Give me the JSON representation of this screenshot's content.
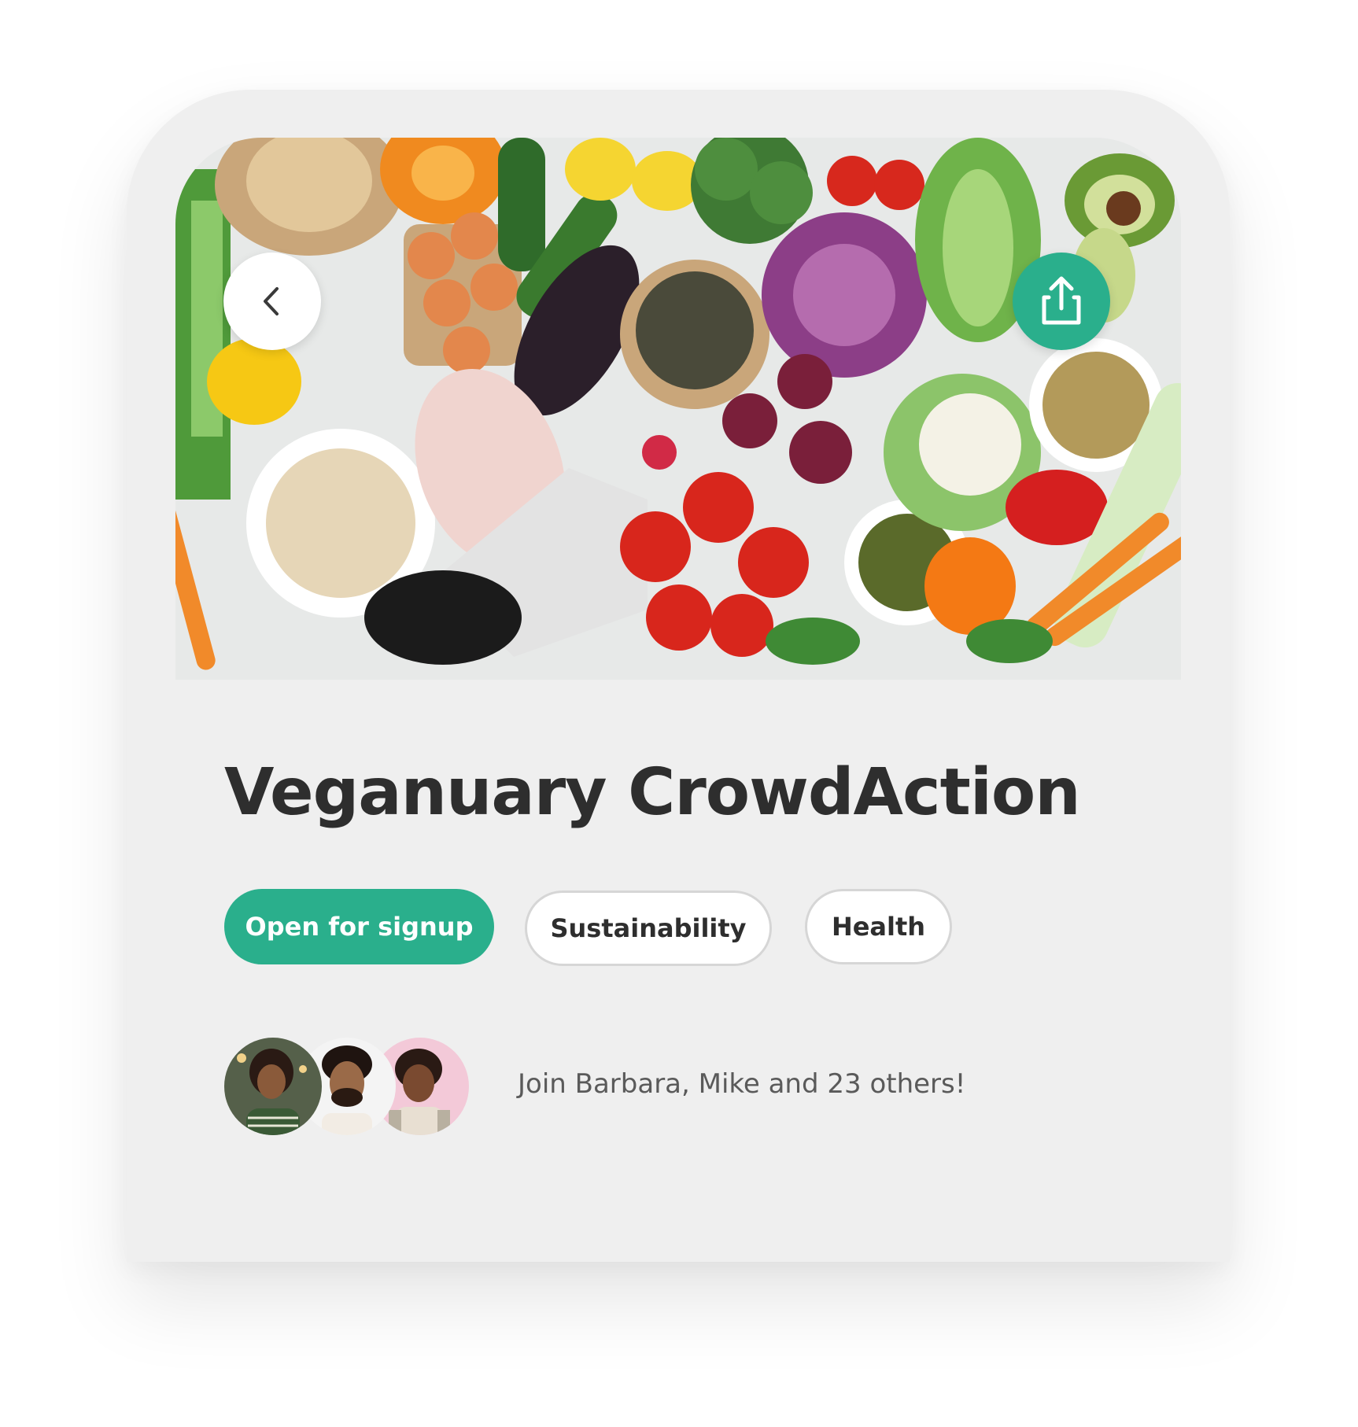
{
  "hero": {
    "image": "vegetables-flatlay",
    "back_icon": "chevron-left-icon",
    "share_icon": "share-icon"
  },
  "title": "Veganuary CrowdAction",
  "chips": {
    "status": "Open for signup",
    "tags": [
      "Sustainability",
      "Health"
    ]
  },
  "participants": {
    "avatars": [
      "avatar-barbara",
      "avatar-mike",
      "avatar-participant-3"
    ],
    "text": "Join Barbara, Mike and 23 others!"
  },
  "colors": {
    "accent": "#2aaf8c",
    "background": "#efefef",
    "title": "#2e2e2e",
    "muted_text": "#5a5a5a"
  }
}
